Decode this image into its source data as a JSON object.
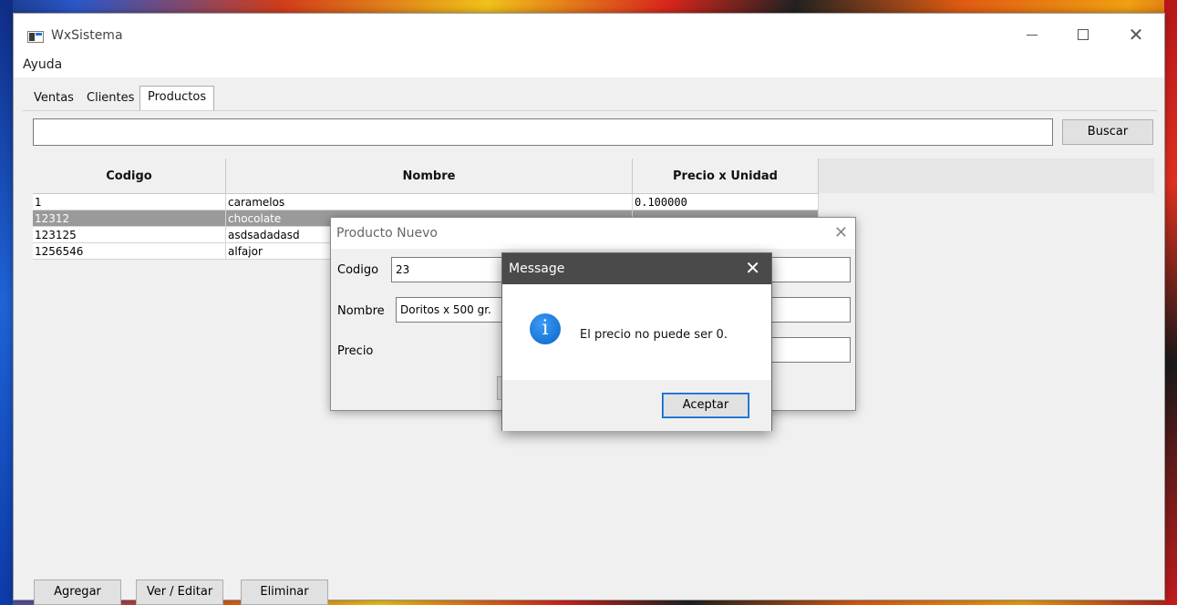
{
  "window": {
    "title": "WxSistema",
    "controls": {
      "minimize": "",
      "maximize": "",
      "close": "✕"
    }
  },
  "menu": {
    "items": [
      "Ayuda"
    ]
  },
  "tabs": [
    "Ventas",
    "Clientes",
    "Productos"
  ],
  "active_tab": "Productos",
  "search": {
    "value": "",
    "button_label": "Buscar"
  },
  "table": {
    "columns": [
      "Codigo",
      "Nombre",
      "Precio x Unidad"
    ],
    "rows": [
      [
        "1",
        "caramelos",
        "0.100000"
      ],
      [
        "12312",
        "chocolate",
        ""
      ],
      [
        "123125",
        "asdsadadasd",
        ""
      ],
      [
        "1256546",
        "alfajor",
        ""
      ]
    ],
    "selected_row": 1
  },
  "actions": {
    "add": "Agregar",
    "edit": "Ver / Editar",
    "delete": "Eliminar"
  },
  "product_dialog": {
    "title": "Producto Nuevo",
    "close": "✕",
    "fields": {
      "codigo_label": "Codigo",
      "codigo_value": "23",
      "nombre_label": "Nombre",
      "nombre_value": "Doritos x 500 gr.",
      "precio_label": "Precio",
      "precio_value": ""
    }
  },
  "message_box": {
    "title": "Message",
    "close": "✕",
    "icon": "info-icon",
    "icon_glyph": "i",
    "text": "El precio no puede ser 0.",
    "button_label": "Aceptar"
  },
  "colors": {
    "selection": "#9a9a9a",
    "message_titlebar": "#4a4a4a",
    "info_icon": "#0a64c8"
  }
}
